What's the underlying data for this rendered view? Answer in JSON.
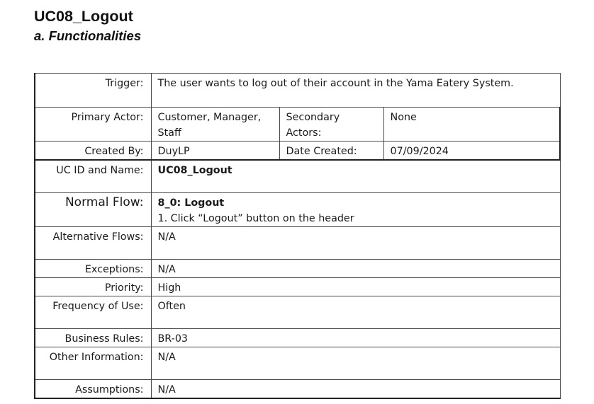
{
  "document": {
    "title": "UC08_Logout",
    "subtitle": "a. Functionalities"
  },
  "use_case": {
    "trigger": {
      "label": "Trigger:",
      "value": "The user wants to log out of their account in the Yama Eatery System."
    },
    "primary_actor": {
      "label": "Primary Actor:",
      "value": "Customer, Manager, Staff"
    },
    "secondary_actors": {
      "label": "Secondary Actors:",
      "value": "None"
    },
    "created_by": {
      "label": "Created By:",
      "value": "DuyLP"
    },
    "date_created": {
      "label": "Date Created:",
      "value": "07/09/2024"
    },
    "uc_id_name": {
      "label": "UC ID and Name:",
      "value": "UC08_Logout"
    },
    "normal_flow": {
      "label": "Normal Flow:",
      "title": "8_0: Logout",
      "steps": [
        "1. Click “Logout” button on the header"
      ]
    },
    "alternative_flows": {
      "label": "Alternative Flows:",
      "value": "N/A"
    },
    "exceptions": {
      "label": "Exceptions:",
      "value": "N/A"
    },
    "priority": {
      "label": "Priority:",
      "value": "High"
    },
    "frequency_of_use": {
      "label": "Frequency of Use:",
      "value": "Often"
    },
    "business_rules": {
      "label": "Business Rules:",
      "value": "BR-03"
    },
    "other_information": {
      "label": "Other Information:",
      "value": "N/A"
    },
    "assumptions": {
      "label": "Assumptions:",
      "value": "N/A"
    }
  }
}
